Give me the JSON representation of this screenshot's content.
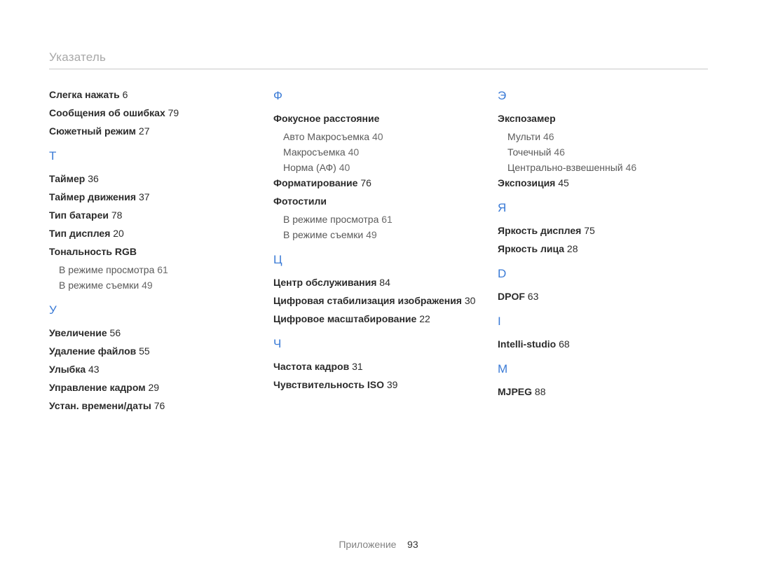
{
  "page_title": "Указатель",
  "footer": {
    "label": "Приложение",
    "page": "93"
  },
  "columns": [
    {
      "groups": [
        {
          "letter": null,
          "items": [
            {
              "label": "Слегка нажать",
              "page": "6"
            },
            {
              "label": "Сообщения об ошибках",
              "page": "79"
            },
            {
              "label": "Сюжетный режим",
              "page": "27"
            }
          ]
        },
        {
          "letter": "Т",
          "items": [
            {
              "label": "Таймер",
              "page": "36"
            },
            {
              "label": "Таймер движения",
              "page": "37"
            },
            {
              "label": "Тип батареи",
              "page": "78"
            },
            {
              "label": "Тип дисплея",
              "page": "20"
            },
            {
              "label": "Тональность RGB",
              "subs": [
                {
                  "label": "В режиме просмотра",
                  "page": "61"
                },
                {
                  "label": "В режиме съемки",
                  "page": "49"
                }
              ]
            }
          ]
        },
        {
          "letter": "У",
          "items": [
            {
              "label": "Увеличение",
              "page": "56"
            },
            {
              "label": "Удаление файлов",
              "page": "55"
            },
            {
              "label": "Улыбка",
              "page": "43"
            },
            {
              "label": "Управление кадром",
              "page": "29"
            },
            {
              "label": "Устан. времени/даты",
              "page": "76"
            }
          ]
        }
      ]
    },
    {
      "groups": [
        {
          "letter": "Ф",
          "items": [
            {
              "label": "Фокусное расстояние",
              "subs": [
                {
                  "label": "Авто Макросъемка",
                  "page": "40"
                },
                {
                  "label": "Макросъемка",
                  "page": "40"
                },
                {
                  "label": "Норма (АФ)",
                  "page": "40"
                }
              ]
            },
            {
              "label": "Форматирование",
              "page": "76"
            },
            {
              "label": "Фотостили",
              "subs": [
                {
                  "label": "В режиме просмотра",
                  "page": "61"
                },
                {
                  "label": "В режиме съемки",
                  "page": "49"
                }
              ]
            }
          ]
        },
        {
          "letter": "Ц",
          "items": [
            {
              "label": "Центр обслуживания",
              "page": "84"
            },
            {
              "label": "Цифровая стабилизация изображения",
              "page": "30"
            },
            {
              "label": "Цифровое масштабирование",
              "page": "22"
            }
          ]
        },
        {
          "letter": "Ч",
          "items": [
            {
              "label": "Частота кадров",
              "page": "31"
            },
            {
              "label": "Чувствительность ISO",
              "page": "39"
            }
          ]
        }
      ]
    },
    {
      "groups": [
        {
          "letter": "Э",
          "items": [
            {
              "label": "Экспозамер",
              "subs": [
                {
                  "label": "Мульти",
                  "page": "46"
                },
                {
                  "label": "Точечный",
                  "page": "46"
                },
                {
                  "label": "Центрально-взвешенный",
                  "page": "46"
                }
              ]
            },
            {
              "label": "Экспозиция",
              "page": "45"
            }
          ]
        },
        {
          "letter": "Я",
          "items": [
            {
              "label": "Яркость дисплея",
              "page": "75"
            },
            {
              "label": "Яркость лица",
              "page": "28"
            }
          ]
        },
        {
          "letter": "D",
          "items": [
            {
              "label": "DPOF",
              "page": "63"
            }
          ]
        },
        {
          "letter": "I",
          "items": [
            {
              "label": "Intelli-studio",
              "page": "68"
            }
          ]
        },
        {
          "letter": "M",
          "items": [
            {
              "label": "MJPEG",
              "page": "88"
            }
          ]
        }
      ]
    }
  ]
}
